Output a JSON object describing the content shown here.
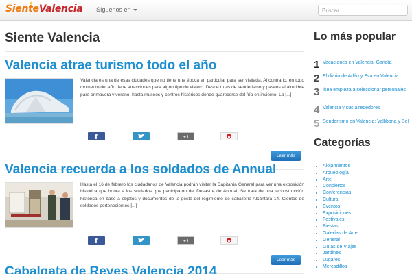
{
  "navbar": {
    "logo_part1": "Siente",
    "logo_part2": "Valencia",
    "menu_label": "Síguenos en",
    "search_placeholder": "Buscar"
  },
  "main": {
    "site_title": "Siente Valencia",
    "articles": [
      {
        "title": "Valencia atrae turismo todo el año",
        "excerpt": "Valencia es una de esas ciudades que no tiene una época en particular para ser visitada. Al contrario, en todo momento del año tiene atracciones para algún tipo de viajero. Desde rutas de senderismo y paseos al aire libre para primavera y verano, hasta museos y centros históricos donde guarecerse del frío en invierno. La [...]",
        "read_more": "Leer más",
        "share_gplus": "+1"
      },
      {
        "title": "Valencia recuerda a los soldados de Annual",
        "excerpt": "Hasta el 16 de febrero los ciudadanos de Valencia podrán visitar la Capitanía General para ver una exposición histórica que honra a los soldados que participaron del Desastre de Annual. Se trata de una reconstrucción histórica en base a objetos y documentos de la gesta del regimiento de caballería Alcántara 14. Cientos de soldados pertenecientes [...]",
        "read_more": "Leer más",
        "share_gplus": "+1"
      },
      {
        "title": "Cabalgata de Reyes Valencia 2014"
      }
    ]
  },
  "sidebar": {
    "popular_heading": "Lo más popular",
    "popular": [
      {
        "num": "1",
        "label": "Vacaciones en Valencia: Gandía",
        "color": "#222222"
      },
      {
        "num": "2",
        "label": "El diario de Adán y Eva en Valencia",
        "color": "#444444"
      },
      {
        "num": "3",
        "label": "Ikea empieza a seleccionar personales",
        "color": "#666666"
      },
      {
        "num": "4",
        "label": "Valencia y sus alrededores",
        "color": "#888888"
      },
      {
        "num": "5",
        "label": "Senderismo en Valencia: Vallibona y Bel",
        "color": "#aaaaaa"
      }
    ],
    "categories_heading": "Categorías",
    "categories": [
      "Alojamientos",
      "Arqueología",
      "Arte",
      "Conciertos",
      "Conferencias",
      "Cultura",
      "Eventos",
      "Exposiciones",
      "Festivales",
      "Fiestas",
      "Galerías de Arte",
      "General",
      "Guías de Viajes",
      "Jardines",
      "Lugares",
      "Mercadillos"
    ]
  },
  "colors": {
    "link_blue": "#1d8fd0",
    "logo_orange": "#f07a0c",
    "logo_red": "#c9262c",
    "facebook": "#3b5998",
    "twitter": "#3494c8",
    "button_blue": "#2a85c9"
  },
  "icons": {
    "share_buttons": [
      "facebook-icon",
      "twitter-icon",
      "google-plus-icon",
      "pinterest-icon"
    ],
    "menu_caret": "chevron-down-icon"
  }
}
